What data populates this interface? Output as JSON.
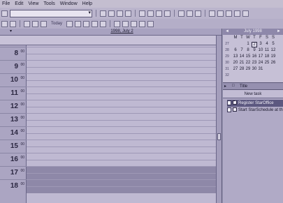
{
  "menu": [
    "File",
    "Edit",
    "View",
    "Tools",
    "Window",
    "Help"
  ],
  "toolbar2": {
    "today_label": "Today"
  },
  "calendar": {
    "date_title": "1998, July 2",
    "hours": [
      {
        "h": "8",
        "m": "00"
      },
      {
        "h": "9",
        "m": "00"
      },
      {
        "h": "10",
        "m": "00"
      },
      {
        "h": "11",
        "m": "00"
      },
      {
        "h": "12",
        "m": "00"
      },
      {
        "h": "13",
        "m": "00"
      },
      {
        "h": "14",
        "m": "00"
      },
      {
        "h": "15",
        "m": "00"
      },
      {
        "h": "16",
        "m": "00"
      },
      {
        "h": "17",
        "m": "00"
      },
      {
        "h": "18",
        "m": "00"
      }
    ]
  },
  "mini_calendar": {
    "title": "July 1998",
    "weekdays": [
      "M",
      "T",
      "W",
      "T",
      "F",
      "S",
      "S"
    ],
    "rows": [
      {
        "wk": "27",
        "days": [
          "",
          "",
          "1",
          "2",
          "3",
          "4",
          "5"
        ]
      },
      {
        "wk": "28",
        "days": [
          "6",
          "7",
          "8",
          "9",
          "10",
          "11",
          "12"
        ]
      },
      {
        "wk": "29",
        "days": [
          "13",
          "14",
          "15",
          "16",
          "17",
          "18",
          "19"
        ]
      },
      {
        "wk": "30",
        "days": [
          "20",
          "21",
          "22",
          "23",
          "24",
          "25",
          "26"
        ]
      },
      {
        "wk": "31",
        "days": [
          "27",
          "28",
          "29",
          "30",
          "31",
          "",
          ""
        ]
      },
      {
        "wk": "32",
        "days": [
          "",
          "",
          "",
          "",
          "",
          "",
          ""
        ]
      }
    ],
    "today": "2"
  },
  "tasks": {
    "header": "Title",
    "new_task": "New task",
    "items": [
      {
        "label": "Register StarOffice",
        "done": true
      },
      {
        "label": "Start StarSchedule at th",
        "done": false
      }
    ]
  }
}
